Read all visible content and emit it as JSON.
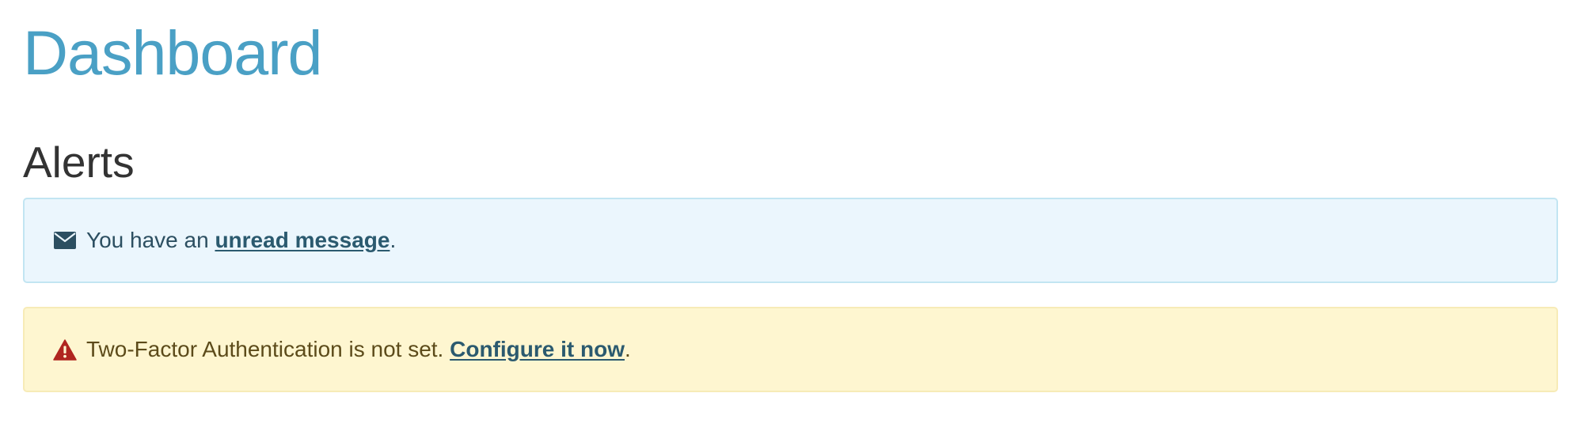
{
  "header": {
    "title": "Dashboard"
  },
  "alerts_section": {
    "heading": "Alerts",
    "info": {
      "icon": "envelope-icon",
      "prefix": "You have an ",
      "link_label": "unread message",
      "suffix": "."
    },
    "warning": {
      "icon": "warning-triangle-icon",
      "prefix": "Two-Factor Authentication is not set. ",
      "link_label": "Configure it now",
      "suffix": "."
    }
  },
  "colors": {
    "title": "#4aa0c5",
    "info_background": "#ebf6fd",
    "info_border": "#c2e5f2",
    "warning_background": "#fef6d0",
    "warning_border": "#f7ebb7",
    "warning_icon": "#b0251f",
    "info_icon": "#2c4f61"
  }
}
